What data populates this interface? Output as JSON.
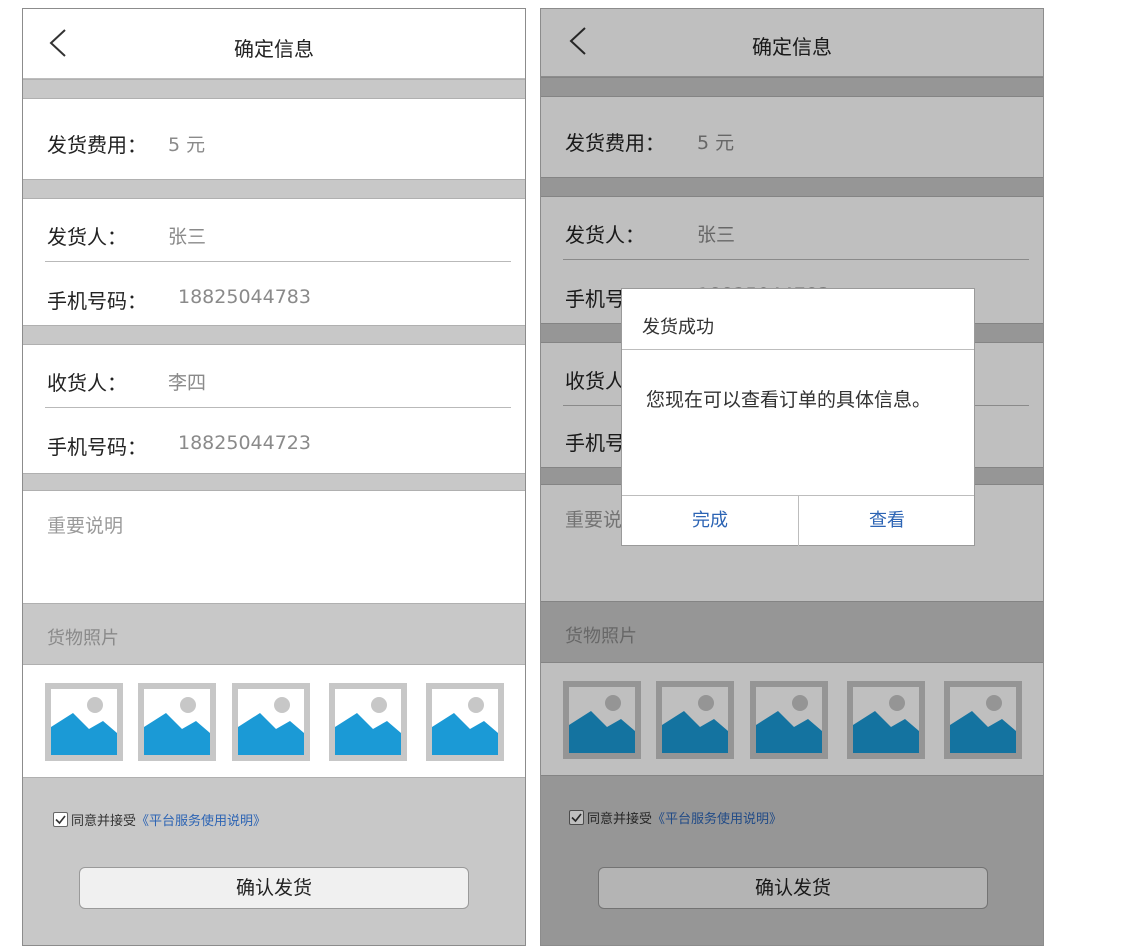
{
  "header": {
    "title": "确定信息"
  },
  "fee": {
    "label": "发货费用：",
    "value": "5 元"
  },
  "sender": {
    "name_label": "发货人：",
    "name": "张三",
    "phone_label": "手机号码：",
    "phone": "18825044783"
  },
  "receiver": {
    "name_label": "收货人：",
    "name": "李四",
    "phone_label": "手机号码：",
    "phone": "18825044723"
  },
  "note": {
    "label": "重要说明"
  },
  "photos": {
    "label": "货物照片",
    "count": 5
  },
  "agreement": {
    "checked": true,
    "text": "同意并接受",
    "link": "《平台服务使用说明》"
  },
  "confirm_label": "确认发货",
  "dialog": {
    "title": "发货成功",
    "message": "您现在可以查看订单的具体信息。",
    "done_label": "完成",
    "view_label": "查看"
  },
  "colors": {
    "accent": "#2c64b4",
    "photo_blue": "#1b9ad6",
    "photo_gray": "#c7c7c7",
    "separator": "#c8c8c8"
  }
}
